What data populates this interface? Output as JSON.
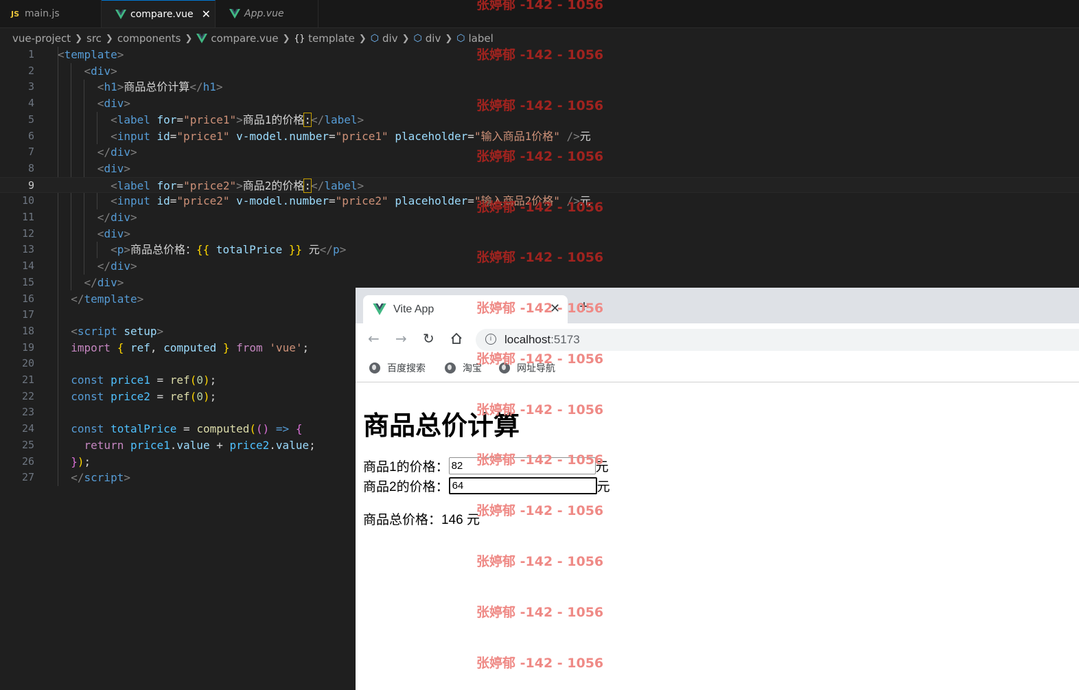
{
  "editor": {
    "tabs": [
      {
        "icon": "JS",
        "label": "main.js"
      },
      {
        "label": "compare.vue",
        "close": "✕"
      },
      {
        "label": "App.vue"
      }
    ],
    "breadcrumb": [
      "vue-project",
      "src",
      "components",
      "compare.vue",
      "template",
      "div",
      "div",
      "label"
    ],
    "line_numbers": [
      "1",
      "2",
      "3",
      "4",
      "5",
      "6",
      "7",
      "8",
      "9",
      "10",
      "11",
      "12",
      "13",
      "14",
      "15",
      "16",
      "17",
      "18",
      "19",
      "20",
      "21",
      "22",
      "23",
      "24",
      "25",
      "26",
      "27"
    ],
    "current_line": 9,
    "code": {
      "l5_text": "商品1的价格",
      "l5_colon": ":",
      "l9_text": "商品2的价格",
      "l9_colon": ":",
      "l3_text": "商品总价计算",
      "l6_placeholder": "\"输入商品1价格\"",
      "l10_placeholder": "\"输入商品2价格\"",
      "unit": "元",
      "l13_text": "商品总价格：",
      "l13_unit": " 元"
    }
  },
  "browser": {
    "tab_title": "Vite App",
    "tab_close": "✕",
    "new_tab": "+",
    "url_host": "localhost",
    "url_port": ":5173",
    "bookmarks": [
      "百度搜索",
      "淘宝",
      "网址导航"
    ],
    "page": {
      "heading": "商品总价计算",
      "label1": "商品1的价格：",
      "value1": "82",
      "label2": "商品2的价格：",
      "value2": "64",
      "unit": "元",
      "total_label": "商品总价格：",
      "total_value": "146 元"
    }
  },
  "watermark": "张婷郁 -142 - 1056"
}
